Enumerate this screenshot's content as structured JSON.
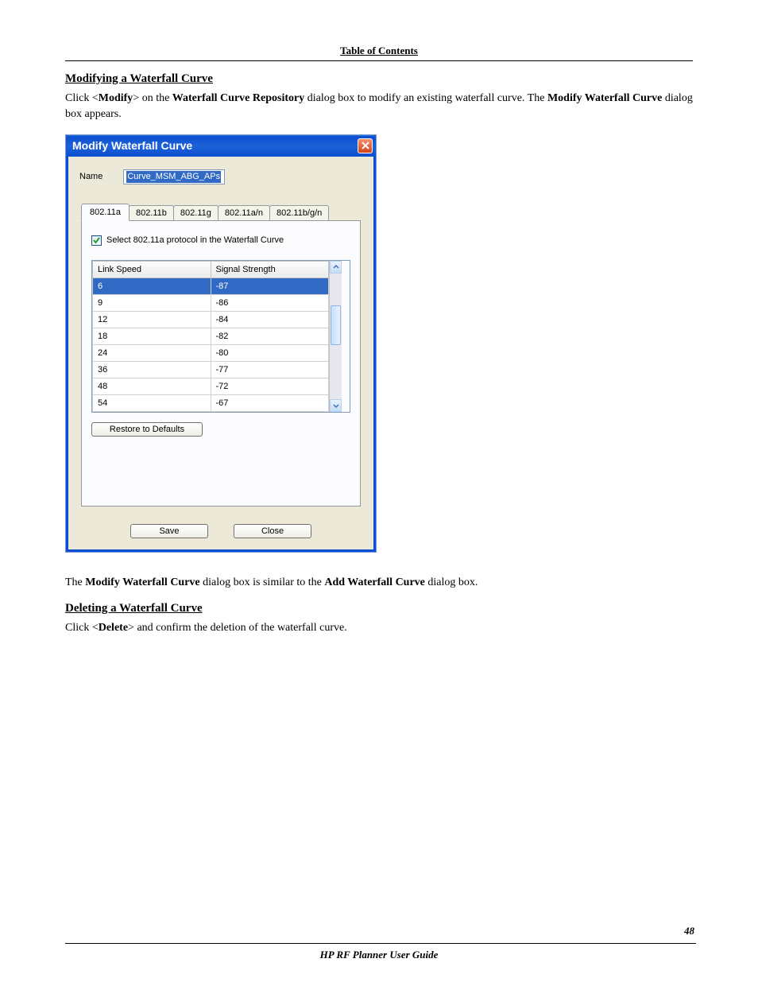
{
  "header": {
    "toc_link": "Table of Contents"
  },
  "section1": {
    "heading": "Modifying a Waterfall Curve",
    "para": [
      "Click <",
      "Modify",
      "> on the ",
      "Waterfall Curve Repository",
      " dialog box to modify an existing waterfall curve. The ",
      "Modify Waterfall Curve",
      " dialog box appears."
    ]
  },
  "dialog": {
    "title": "Modify Waterfall Curve",
    "name_label": "Name",
    "name_value": "Curve_MSM_ABG_APs",
    "tabs": [
      "802.11a",
      "802.11b",
      "802.11g",
      "802.11a/n",
      "802.11b/g/n"
    ],
    "active_tab_index": 0,
    "checkbox_label": "Select 802.11a protocol in the Waterfall Curve",
    "checkbox_checked": true,
    "columns": [
      "Link Speed",
      "Signal Strength"
    ],
    "rows": [
      {
        "link": "6",
        "signal": "-87",
        "selected": true
      },
      {
        "link": "9",
        "signal": "-86"
      },
      {
        "link": "12",
        "signal": "-84"
      },
      {
        "link": "18",
        "signal": "-82"
      },
      {
        "link": "24",
        "signal": "-80"
      },
      {
        "link": "36",
        "signal": "-77"
      },
      {
        "link": "48",
        "signal": "-72"
      },
      {
        "link": "54",
        "signal": "-67"
      }
    ],
    "restore_label": "Restore to Defaults",
    "save_label": "Save",
    "close_label": "Close"
  },
  "after_dialog": {
    "para": [
      "The ",
      "Modify Waterfall Curve",
      " dialog box is similar to the ",
      "Add Waterfall Curve",
      " dialog box."
    ]
  },
  "section2": {
    "heading": "Deleting a Waterfall Curve",
    "para": [
      "Click <",
      "Delete",
      "> and confirm the deletion of the waterfall curve."
    ]
  },
  "footer": {
    "page_number": "48",
    "guide": "HP RF Planner User Guide"
  }
}
